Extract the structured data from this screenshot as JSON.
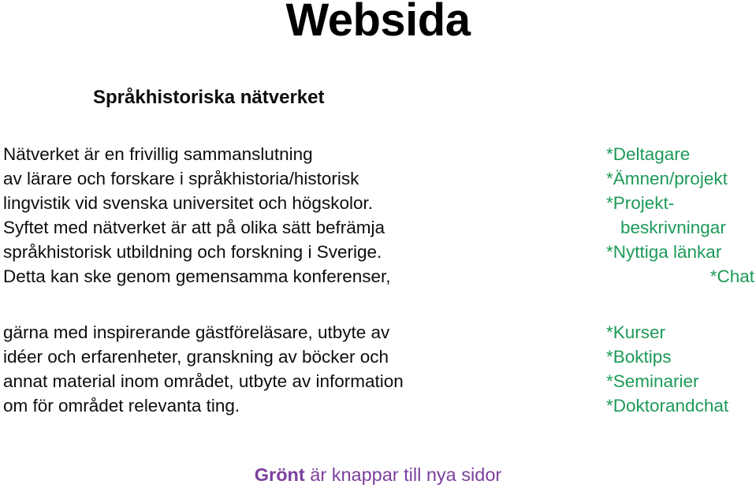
{
  "slide": {
    "title": "Websida",
    "section_heading": "Språkhistoriska nätverket",
    "colors": {
      "text": "#0d0d0d",
      "green_accent": "#1d9a57",
      "purple_accent": "#7b3f9d",
      "background": "#ffffff"
    }
  },
  "body": {
    "paragraph_1": {
      "lines": [
        "Nätverket är en frivillig sammanslutning",
        "av lärare och forskare i språkhistoria/historisk",
        "lingvistik vid svenska universitet och högskolor.",
        "Syftet med nätverket är att på olika sätt befrämja",
        "språkhistorisk utbildning och forskning i Sverige.",
        "Detta kan ske genom gemensamma konferenser,"
      ]
    },
    "paragraph_2": {
      "lines": [
        "gärna med inspirerande gästföreläsare, utbyte av",
        "idéer och erfarenheter, granskning av böcker och",
        "annat material inom området, utbyte av information",
        "om för området relevanta ting."
      ]
    }
  },
  "green_links": {
    "group_1": [
      "*Deltagare",
      "*Ämnen/projekt",
      "*Projekt-",
      "beskrivningar",
      "*Nyttiga länkar",
      "*Chat"
    ],
    "group_2": [
      "*Kurser",
      "*Boktips",
      "*Seminarier",
      "*Doktorandchat"
    ]
  },
  "footer": {
    "strong_word": "Grönt",
    "rest": " är knappar till nya sidor"
  }
}
